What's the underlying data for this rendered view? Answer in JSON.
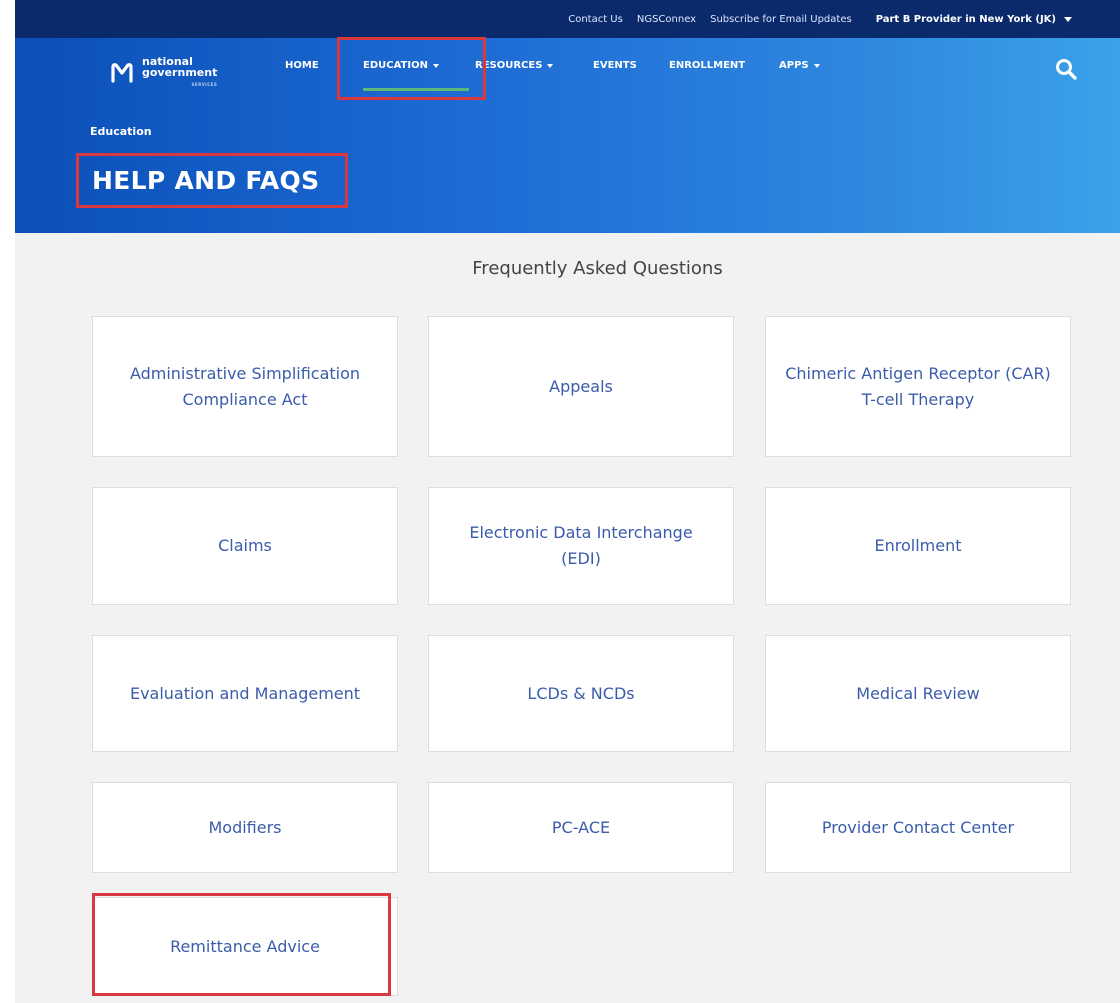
{
  "utility": {
    "links": [
      "Contact Us",
      "NGSConnex",
      "Subscribe for Email Updates"
    ],
    "region_label": "Part B Provider in New York (JK)"
  },
  "logo": {
    "line1": "national",
    "line2": "government",
    "line3": "SERVICES"
  },
  "nav": {
    "home": "HOME",
    "education": "EDUCATION",
    "resources": "RESOURCES",
    "events": "EVENTS",
    "enrollment": "ENROLLMENT",
    "apps": "APPS"
  },
  "breadcrumb": "Education",
  "page_title": "HELP AND FAQS",
  "section_title": "Frequently Asked Questions",
  "faq_items": [
    "Administrative Simplification Compliance Act",
    "Appeals",
    "Chimeric Antigen Receptor (CAR) T-cell Therapy",
    "Claims",
    "Electronic Data Interchange (EDI)",
    "Enrollment",
    "Evaluation and Management",
    "LCDs & NCDs",
    "Medical Review",
    "Modifiers",
    "PC-ACE",
    "Provider Contact Center",
    "Remittance Advice"
  ],
  "colors": {
    "utility_bar": "#0a2a6b",
    "hero_start": "#0b4fb8",
    "hero_end": "#3aa2ea",
    "card_text": "#3a5caa",
    "highlight": "#d9383f",
    "nav_underline": "#5fb87a"
  }
}
